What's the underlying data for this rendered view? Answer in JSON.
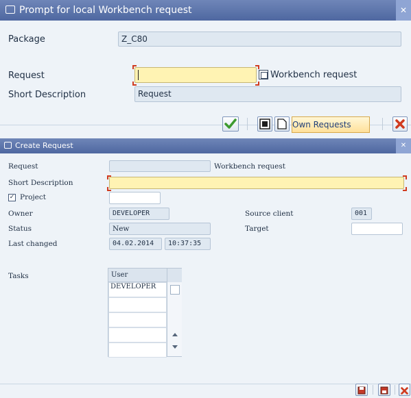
{
  "dialog1": {
    "title": "Prompt for local Workbench request",
    "package_label": "Package",
    "package_value": "Z_C80",
    "request_label": "Request",
    "request_value": "",
    "workbench_request_label": "Workbench request",
    "short_description_label": "Short Description",
    "short_description_value": "Request",
    "own_requests_button": "Own Requests"
  },
  "dialog2": {
    "title": "Create Request",
    "request_label": "Request",
    "request_value": "",
    "request_type": "Workbench request",
    "short_description_label": "Short Description",
    "short_description_value": "",
    "project_label": "Project",
    "project_value": "",
    "owner_label": "Owner",
    "owner_value": "DEVELOPER",
    "status_label": "Status",
    "status_value": "New",
    "last_changed_label": "Last changed",
    "last_changed_date": "04.02.2014",
    "last_changed_time": "10:37:35",
    "source_client_label": "Source client",
    "source_client_value": "001",
    "target_label": "Target",
    "target_value": "",
    "tasks_label": "Tasks",
    "tasks_table": {
      "header": "User",
      "rows": [
        "DEVELOPER",
        "",
        "",
        "",
        "",
        ""
      ]
    }
  },
  "colors": {
    "title_bar": "#5a72a8",
    "required_field": "#fff3b3",
    "close_red": "#d03b1f",
    "confirm_green": "#3d9a2f"
  },
  "icons": {
    "title_icon": "window-prompt-icon",
    "confirm": "checkmark-icon",
    "cancel": "close-red-icon"
  }
}
